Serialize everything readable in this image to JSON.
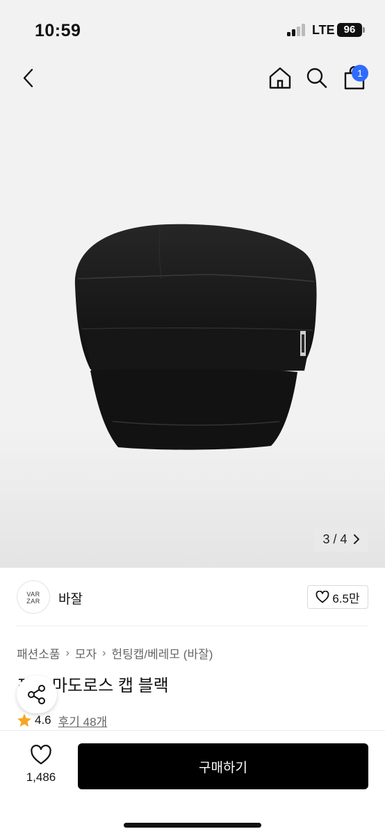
{
  "status_bar": {
    "time": "10:59",
    "network": "LTE",
    "battery": "96"
  },
  "nav": {
    "cart_count": "1",
    "icons": [
      "back-arrow-icon",
      "home-icon",
      "search-icon",
      "shopping-bag-icon"
    ]
  },
  "gallery": {
    "pager_label": "3 / 4"
  },
  "seller": {
    "logo_line1": "VAR",
    "logo_line2": "ZAR",
    "name": "바잘",
    "like_count": "6.5만"
  },
  "breadcrumb": [
    "패션소품",
    "모자",
    "헌팅캡/베레모 (바잘)"
  ],
  "product": {
    "title": "포켓 마도로스 캡 블랙",
    "rating": "4.6",
    "review_label": "후기 48개"
  },
  "bottom_bar": {
    "wish_count": "1,486",
    "buy_label": "구매하기"
  },
  "colors": {
    "badge": "#2f6bff",
    "buy_button": "#000000",
    "star": "#f5a623"
  }
}
